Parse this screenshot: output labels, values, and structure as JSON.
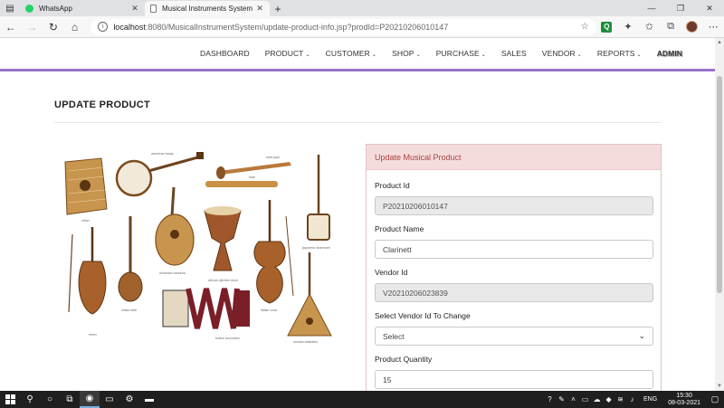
{
  "browser": {
    "tabs": [
      {
        "title": "WhatsApp",
        "active": false,
        "icon": "whatsapp-icon"
      },
      {
        "title": "Musical Instruments System",
        "active": true,
        "icon": "document-icon"
      }
    ],
    "url_host": "localhost",
    "url_path": ":8080/MusicalInstrumentSystem/update-product-info.jsp?prodId=P20210206010147"
  },
  "navbar": {
    "items": [
      {
        "label": "DASHBOARD",
        "dropdown": false
      },
      {
        "label": "PRODUCT",
        "dropdown": true
      },
      {
        "label": "CUSTOMER",
        "dropdown": true
      },
      {
        "label": "SHOP",
        "dropdown": true
      },
      {
        "label": "PURCHASE",
        "dropdown": true
      },
      {
        "label": "SALES",
        "dropdown": false
      },
      {
        "label": "VENDOR",
        "dropdown": true
      },
      {
        "label": "REPORTS",
        "dropdown": true
      },
      {
        "label": "ADMIN",
        "dropdown": false
      }
    ],
    "accent": "#9a72c9"
  },
  "page": {
    "title": "UPDATE PRODUCT"
  },
  "instruments_image": {
    "labels": [
      "zither",
      "american banjo",
      "reed pipe",
      "flute",
      "japanese shamisen",
      "indian sitar",
      "ukrainian bandura",
      "african djembe drum",
      "italian viola",
      "rebec",
      "button accordion",
      "russian balalaika"
    ]
  },
  "form": {
    "header": "Update Musical Product",
    "header_color": "#a94442",
    "fields": {
      "product_id": {
        "label": "Product Id",
        "value": "P20210206010147",
        "readonly": true
      },
      "product_name": {
        "label": "Product Name",
        "value": "Clarinett",
        "readonly": false
      },
      "vendor_id": {
        "label": "Vendor Id",
        "value": "V20210206023839",
        "readonly": true
      },
      "vendor_select": {
        "label": "Select Vendor Id To Change",
        "value": "Select"
      },
      "quantity": {
        "label": "Product Quantity",
        "value": "15"
      }
    }
  },
  "taskbar": {
    "language": "ENG",
    "time": "15:30",
    "date": "08-03-2021"
  }
}
